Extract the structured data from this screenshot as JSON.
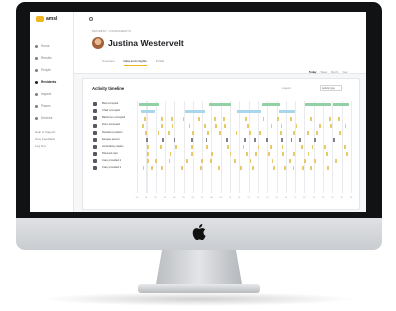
{
  "app": {
    "logo_text": "amsl"
  },
  "colors": {
    "accent": "#f2b41c",
    "green": "#8fd0a5",
    "blue": "#a9d6ea",
    "yellow": "#e8c96a",
    "gray": "#7c8189"
  },
  "sidebar": {
    "items": [
      {
        "label": "Home",
        "icon": "home-icon"
      },
      {
        "label": "Results",
        "icon": "chart-icon"
      },
      {
        "label": "People",
        "icon": "people-icon"
      },
      {
        "label": "Residents",
        "icon": "residents-icon",
        "active": true
      },
      {
        "label": "Inspect",
        "icon": "inspect-icon"
      },
      {
        "label": "Places",
        "icon": "place-icon"
      },
      {
        "label": "Devices",
        "icon": "device-icon"
      }
    ],
    "links": [
      "Help & Support",
      "Give Feedback",
      "Log Out"
    ]
  },
  "profile": {
    "breadcrumb": "RESIDENT / ASSESSMENTS",
    "name": "Justina Westervelt",
    "tabs": [
      {
        "label": "Overview"
      },
      {
        "label": "Data and insights",
        "active": true
      },
      {
        "label": "Profile"
      }
    ]
  },
  "timeline": {
    "title": "Activity timeline",
    "legend_label": "Legend",
    "select_value": "Activity type",
    "ranges": [
      {
        "label": "Today",
        "active": true
      },
      {
        "label": "Week"
      },
      {
        "label": "Month"
      },
      {
        "label": "Year"
      }
    ],
    "rows": [
      {
        "label": "Bed occupied",
        "kind": "segments",
        "color": "green"
      },
      {
        "label": "Chair occupied",
        "kind": "segments",
        "color": "blue"
      },
      {
        "label": "Bathroom occupied",
        "kind": "ticks",
        "color": "yellow"
      },
      {
        "label": "Door accessed",
        "kind": "ticks",
        "color": "yellow"
      },
      {
        "label": "Resident position",
        "kind": "ticks",
        "color": "yellow"
      },
      {
        "label": "Escape sensor",
        "kind": "ticks",
        "color": "gray"
      },
      {
        "label": "Ambulatory status",
        "kind": "ticks",
        "color": "yellow"
      },
      {
        "label": "Planned care",
        "kind": "ticks",
        "color": "yellow"
      },
      {
        "label": "Care provided 1",
        "kind": "ticks",
        "color": "yellow"
      },
      {
        "label": "Care provided 2",
        "kind": "ticks",
        "color": "yellow"
      }
    ],
    "axis_labels": [
      "00",
      "01",
      "02",
      "03",
      "04",
      "05",
      "06",
      "07",
      "08",
      "09",
      "10",
      "11",
      "12",
      "13",
      "14",
      "15",
      "16",
      "17",
      "18",
      "19",
      "20",
      "21",
      "22",
      "23"
    ]
  }
}
